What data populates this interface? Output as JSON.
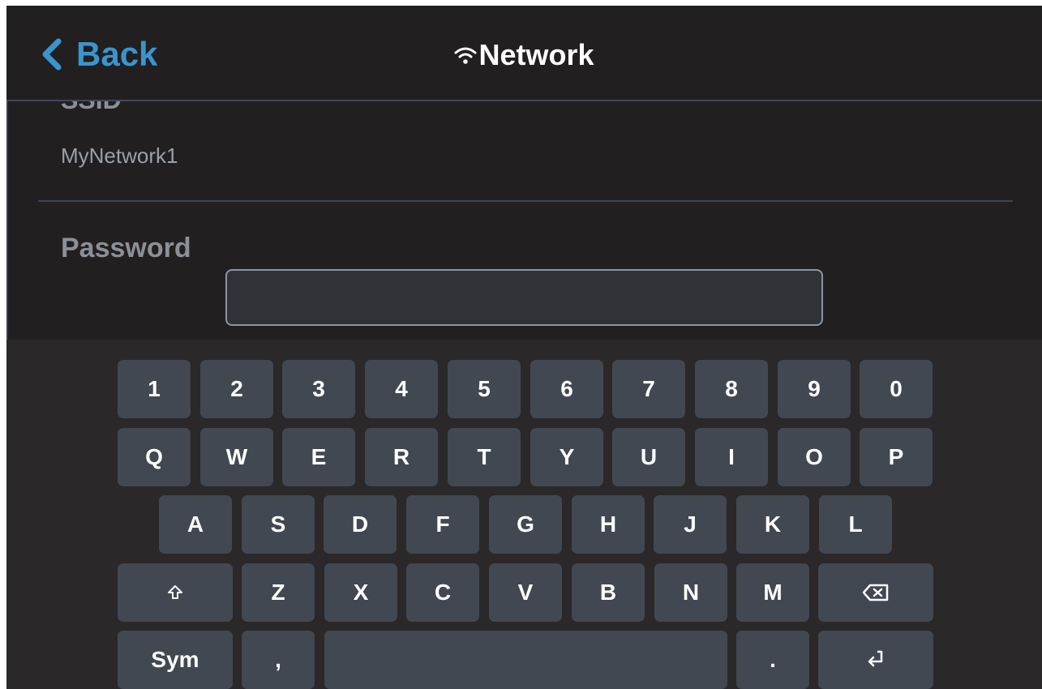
{
  "header": {
    "back_label": "Back",
    "title": "Network",
    "back_icon": "chevron-left-icon",
    "title_icon": "wifi-icon",
    "accent_color": "#3a95cf"
  },
  "network": {
    "ssid_label": "SSID",
    "ssid_value": "MyNetwork1",
    "password_label": "Password",
    "password_value": ""
  },
  "keyboard": {
    "row_numbers": [
      "1",
      "2",
      "3",
      "4",
      "5",
      "6",
      "7",
      "8",
      "9",
      "0"
    ],
    "row_top": [
      "Q",
      "W",
      "E",
      "R",
      "T",
      "Y",
      "U",
      "I",
      "O",
      "P"
    ],
    "row_home": [
      "A",
      "S",
      "D",
      "F",
      "G",
      "H",
      "J",
      "K",
      "L"
    ],
    "row_bottom": [
      "Z",
      "X",
      "C",
      "V",
      "B",
      "N",
      "M"
    ],
    "shift_icon": "shift-arrow-icon",
    "backspace_icon": "backspace-icon",
    "sym_label": "Sym",
    "comma_label": ",",
    "space_label": "",
    "period_label": ".",
    "enter_icon": "enter-return-icon"
  }
}
